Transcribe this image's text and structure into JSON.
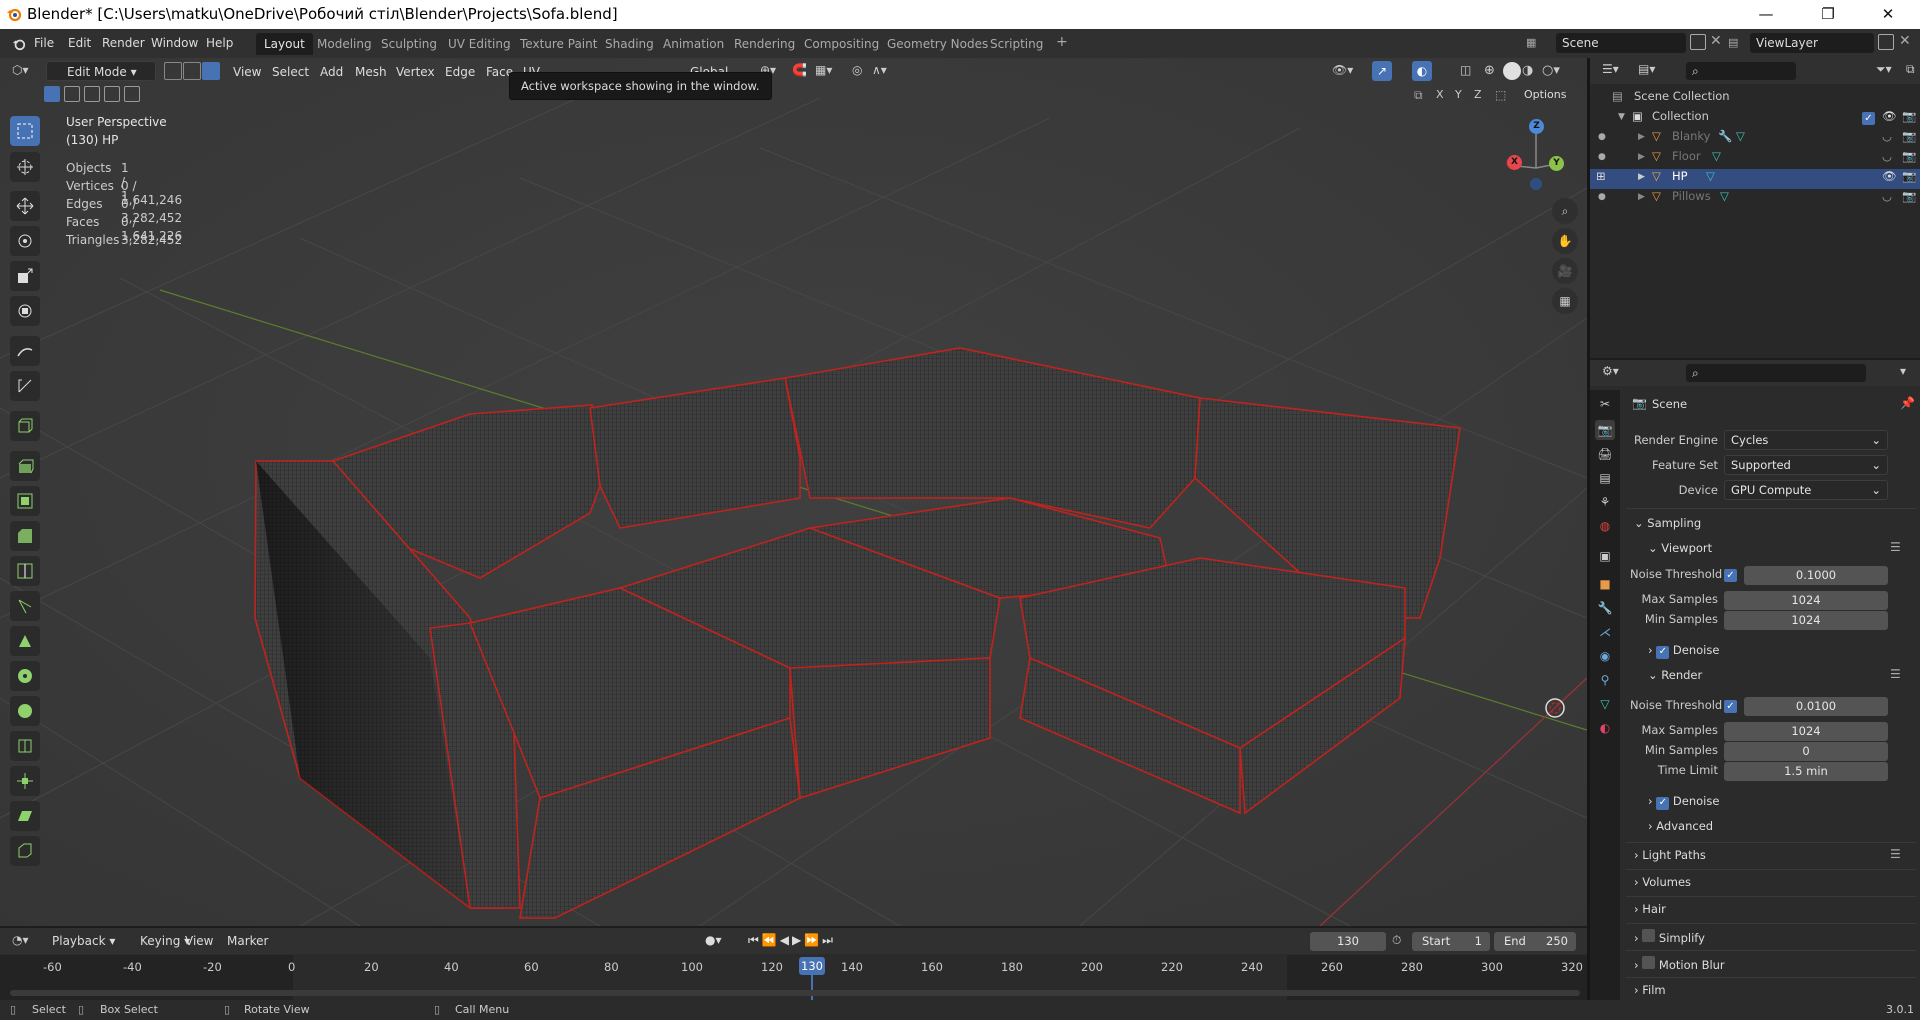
{
  "window": {
    "title": "Blender* [C:\\Users\\matku\\OneDrive\\Робочий стіл\\Blender\\Projects\\Sofa.blend]",
    "min": "—",
    "max": "❐",
    "close": "✕"
  },
  "menus": [
    "File",
    "Edit",
    "Render",
    "Window",
    "Help"
  ],
  "workspaces": [
    "Layout",
    "Modeling",
    "Sculpting",
    "UV Editing",
    "Texture Paint",
    "Shading",
    "Animation",
    "Rendering",
    "Compositing",
    "Geometry Nodes",
    "Scripting",
    "+"
  ],
  "scene": {
    "name": "Scene",
    "view_layer": "ViewLayer"
  },
  "viewport": {
    "mode": "Edit Mode",
    "menus": [
      "View",
      "Select",
      "Add",
      "Mesh",
      "Vertex",
      "Edge",
      "Face",
      "UV"
    ],
    "orientation": "Global",
    "axis_x": "X",
    "axis_y": "Y",
    "axis_z": "Z",
    "options": "Options",
    "perspective": "User Perspective",
    "object_label": "(130) HP",
    "stats": [
      {
        "label": "Objects",
        "value": "1 / 1"
      },
      {
        "label": "Vertices",
        "value": "0 / 1,641,246"
      },
      {
        "label": "Edges",
        "value": "0 / 3,282,452"
      },
      {
        "label": "Faces",
        "value": "0 / 1,641,226"
      },
      {
        "label": "Triangles",
        "value": "3,282,452"
      }
    ],
    "tooltip": "Active workspace showing in the window.",
    "gizmo": {
      "x": "X",
      "y": "Y",
      "z": "Z"
    }
  },
  "outliner": {
    "root": "Scene Collection",
    "collection": "Collection",
    "items": [
      {
        "name": "Blanky",
        "selected": false
      },
      {
        "name": "Floor",
        "selected": false
      },
      {
        "name": "HP",
        "selected": true
      },
      {
        "name": "Pillows",
        "selected": false
      }
    ]
  },
  "properties": {
    "context": "Scene",
    "render_engine": {
      "label": "Render Engine",
      "value": "Cycles"
    },
    "feature_set": {
      "label": "Feature Set",
      "value": "Supported"
    },
    "device": {
      "label": "Device",
      "value": "GPU Compute"
    },
    "sampling": "Sampling",
    "viewport_panel": "Viewport",
    "render_panel": "Render",
    "noise_threshold_label": "Noise Threshold",
    "max_samples_label": "Max Samples",
    "min_samples_label": "Min Samples",
    "time_limit_label": "Time Limit",
    "viewport_noise": "0.1000",
    "viewport_max": "1024",
    "viewport_min": "1024",
    "render_noise": "0.0100",
    "render_max": "1024",
    "render_min": "0",
    "render_time_limit": "1.5 min",
    "denoise": "Denoise",
    "advanced": "Advanced",
    "light_paths": "Light Paths",
    "volumes": "Volumes",
    "hair": "Hair",
    "simplify": "Simplify",
    "motion_blur": "Motion Blur",
    "film": "Film"
  },
  "timeline": {
    "menus": [
      "Playback",
      "Keying",
      "View",
      "Marker"
    ],
    "current_frame": "130",
    "start_label": "Start",
    "start": "1",
    "end_label": "End",
    "end": "250",
    "ticks": [
      "-60",
      "-40",
      "-20",
      "0",
      "20",
      "40",
      "60",
      "80",
      "100",
      "120",
      "130",
      "140",
      "160",
      "180",
      "200",
      "220",
      "240",
      "260",
      "280",
      "300",
      "320"
    ]
  },
  "statusbar": {
    "select": "Select",
    "box_select": "Box Select",
    "rotate": "Rotate View",
    "call_menu": "Call Menu",
    "version": "3.0.1"
  },
  "colors": {
    "accent": "#4772b3",
    "selected_edge": "#c0231d",
    "active_frame": "#4772b3"
  }
}
